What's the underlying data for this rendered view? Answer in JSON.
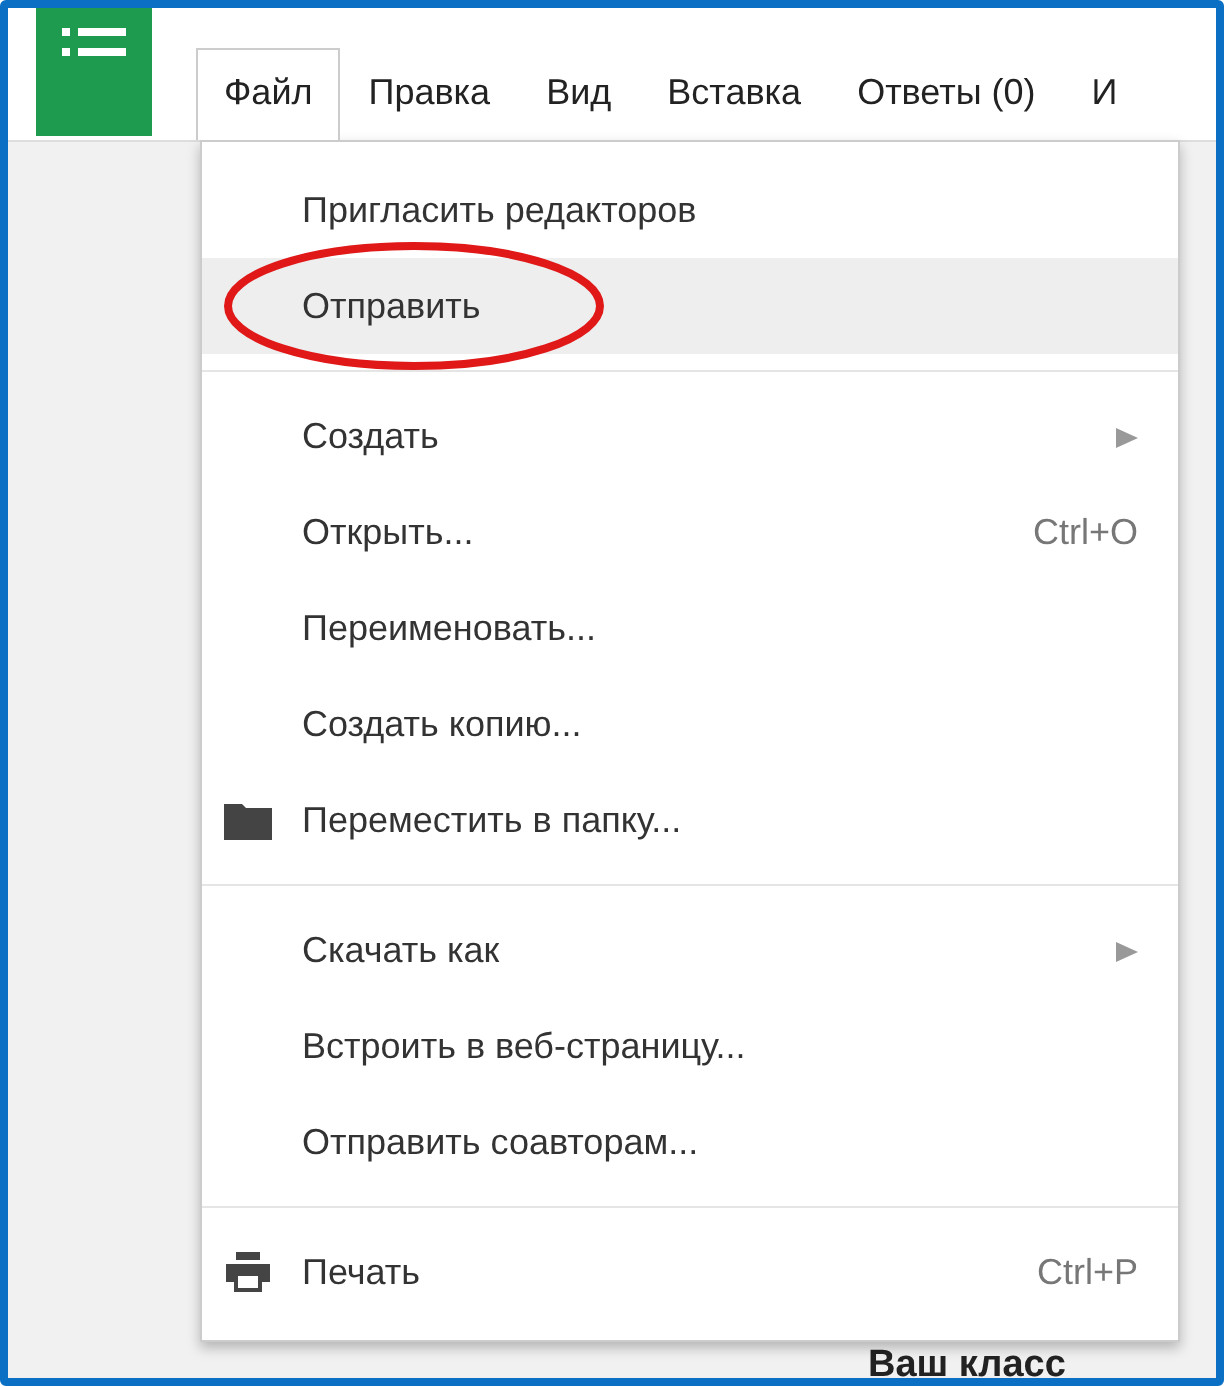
{
  "menubar": [
    {
      "label": "Файл",
      "selected": true
    },
    {
      "label": "Правка",
      "selected": false
    },
    {
      "label": "Вид",
      "selected": false
    },
    {
      "label": "Вставка",
      "selected": false
    },
    {
      "label": "Ответы (0)",
      "selected": false
    },
    {
      "label": "И",
      "selected": false
    }
  ],
  "menu": [
    {
      "kind": "item",
      "label": "Пригласить редакторов",
      "highlighted": false,
      "circled": false
    },
    {
      "kind": "item",
      "label": "Отправить",
      "highlighted": true,
      "circled": true
    },
    {
      "kind": "divider"
    },
    {
      "kind": "item",
      "label": "Создать",
      "submenu": true,
      "highlighted": false,
      "circled": false
    },
    {
      "kind": "item",
      "label": "Открыть...",
      "shortcut": "Ctrl+O",
      "highlighted": false,
      "circled": false
    },
    {
      "kind": "item",
      "label": "Переименовать...",
      "highlighted": false,
      "circled": false
    },
    {
      "kind": "item",
      "label": "Создать копию...",
      "highlighted": false,
      "circled": false
    },
    {
      "kind": "folder",
      "label": "Переместить в папку...",
      "highlighted": false,
      "circled": false
    },
    {
      "kind": "divider"
    },
    {
      "kind": "item",
      "label": "Скачать как",
      "submenu": true,
      "highlighted": false,
      "circled": false
    },
    {
      "kind": "item",
      "label": "Встроить в веб-страницу...",
      "highlighted": false,
      "circled": false
    },
    {
      "kind": "item",
      "label": "Отправить соавторам...",
      "highlighted": false,
      "circled": false
    },
    {
      "kind": "divider"
    },
    {
      "kind": "printer",
      "label": "Печать",
      "shortcut": "Ctrl+P",
      "highlighted": false,
      "circled": false
    }
  ],
  "background_text": [
    "Ваш класс"
  ]
}
